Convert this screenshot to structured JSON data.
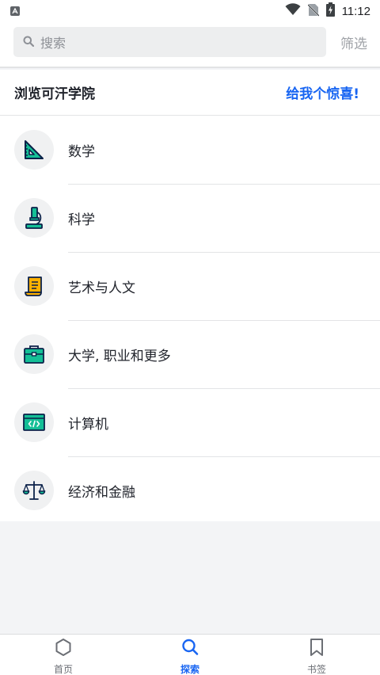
{
  "status_bar": {
    "time": "11:12"
  },
  "search": {
    "placeholder": "搜索",
    "filter_label": "筛选"
  },
  "section": {
    "title": "浏览可汗学院",
    "surprise_link": "给我个惊喜!"
  },
  "domains": [
    {
      "label": "数学",
      "icon": "triangle-ruler-icon"
    },
    {
      "label": "科学",
      "icon": "microscope-icon"
    },
    {
      "label": "艺术与人文",
      "icon": "scroll-icon"
    },
    {
      "label": "大学, 职业和更多",
      "icon": "briefcase-icon"
    },
    {
      "label": "计算机",
      "icon": "code-window-icon"
    },
    {
      "label": "经济和金融",
      "icon": "balance-scale-icon"
    }
  ],
  "bottom_nav": {
    "tabs": [
      {
        "label": "首页",
        "icon": "hexagon-icon",
        "active": false
      },
      {
        "label": "探索",
        "icon": "search-icon",
        "active": true
      },
      {
        "label": "书签",
        "icon": "bookmark-icon",
        "active": false
      }
    ]
  },
  "colors": {
    "accent": "#1865f2",
    "icon_green": "#14bf96",
    "icon_gold": "#ffb100",
    "icon_dark": "#0b2149"
  }
}
